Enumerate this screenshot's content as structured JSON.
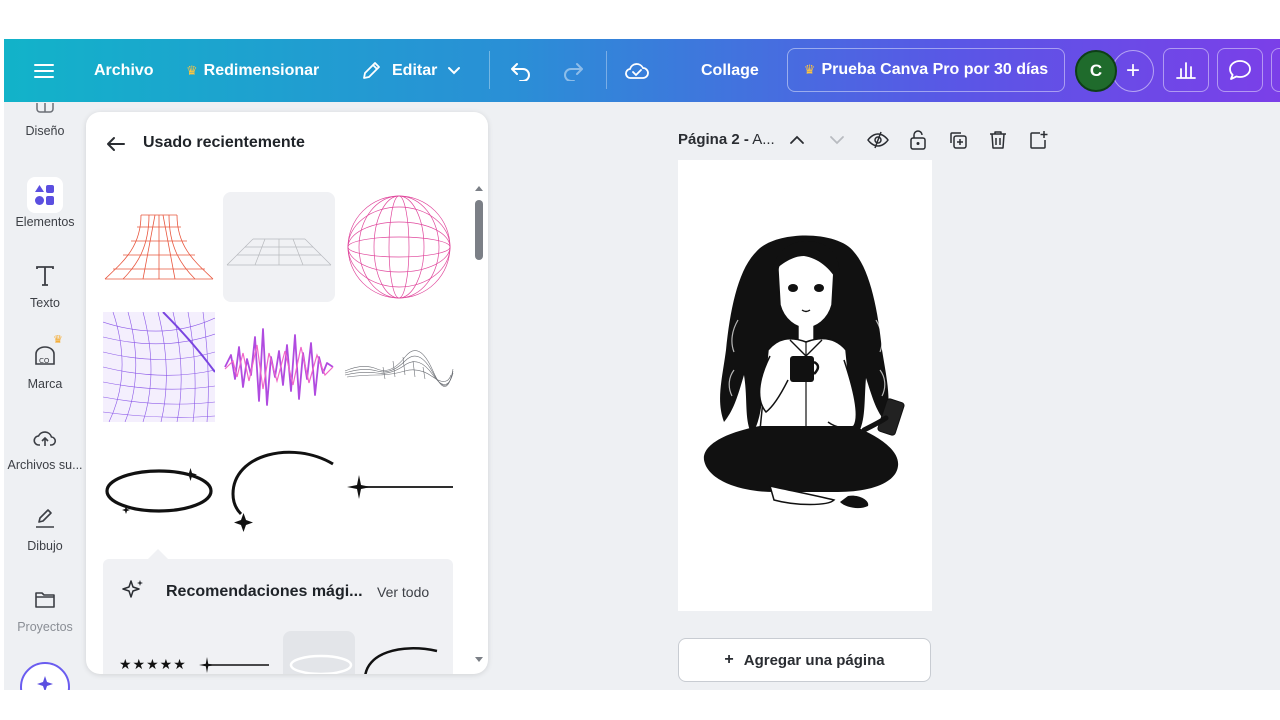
{
  "topbar": {
    "menu_icon": "hamburger-icon",
    "file_label": "Archivo",
    "resize_label": "Redimensionar",
    "edit_label": "Editar",
    "project_title": "Collage",
    "trial_label": "Prueba Canva Pro por 30 días",
    "avatar_initial": "C",
    "add_member": "+"
  },
  "rail": {
    "items": [
      {
        "label": "Diseño",
        "icon": "layout-icon"
      },
      {
        "label": "Elementos",
        "icon": "shapes-icon",
        "active": true
      },
      {
        "label": "Texto",
        "icon": "text-icon"
      },
      {
        "label": "Marca",
        "icon": "brand-icon"
      },
      {
        "label": "Archivos su...",
        "icon": "upload-cloud-icon"
      },
      {
        "label": "Dibujo",
        "icon": "draw-icon"
      },
      {
        "label": "Proyectos",
        "icon": "folder-icon"
      }
    ]
  },
  "panel": {
    "title": "Usado recientemente",
    "magic_title": "Recomendaciones mági...",
    "see_all": "Ver todo",
    "magic_stars": "★★★★★"
  },
  "page": {
    "label_bold": "Página 2 -",
    "label_rest": " A...",
    "add_page": "Agregar una página",
    "add_page_plus": "+"
  },
  "colors": {
    "accent_start": "#12b3c9",
    "accent_end": "#7b3fe8",
    "crown": "#ffc53d",
    "avatar": "#1f6b2c"
  }
}
